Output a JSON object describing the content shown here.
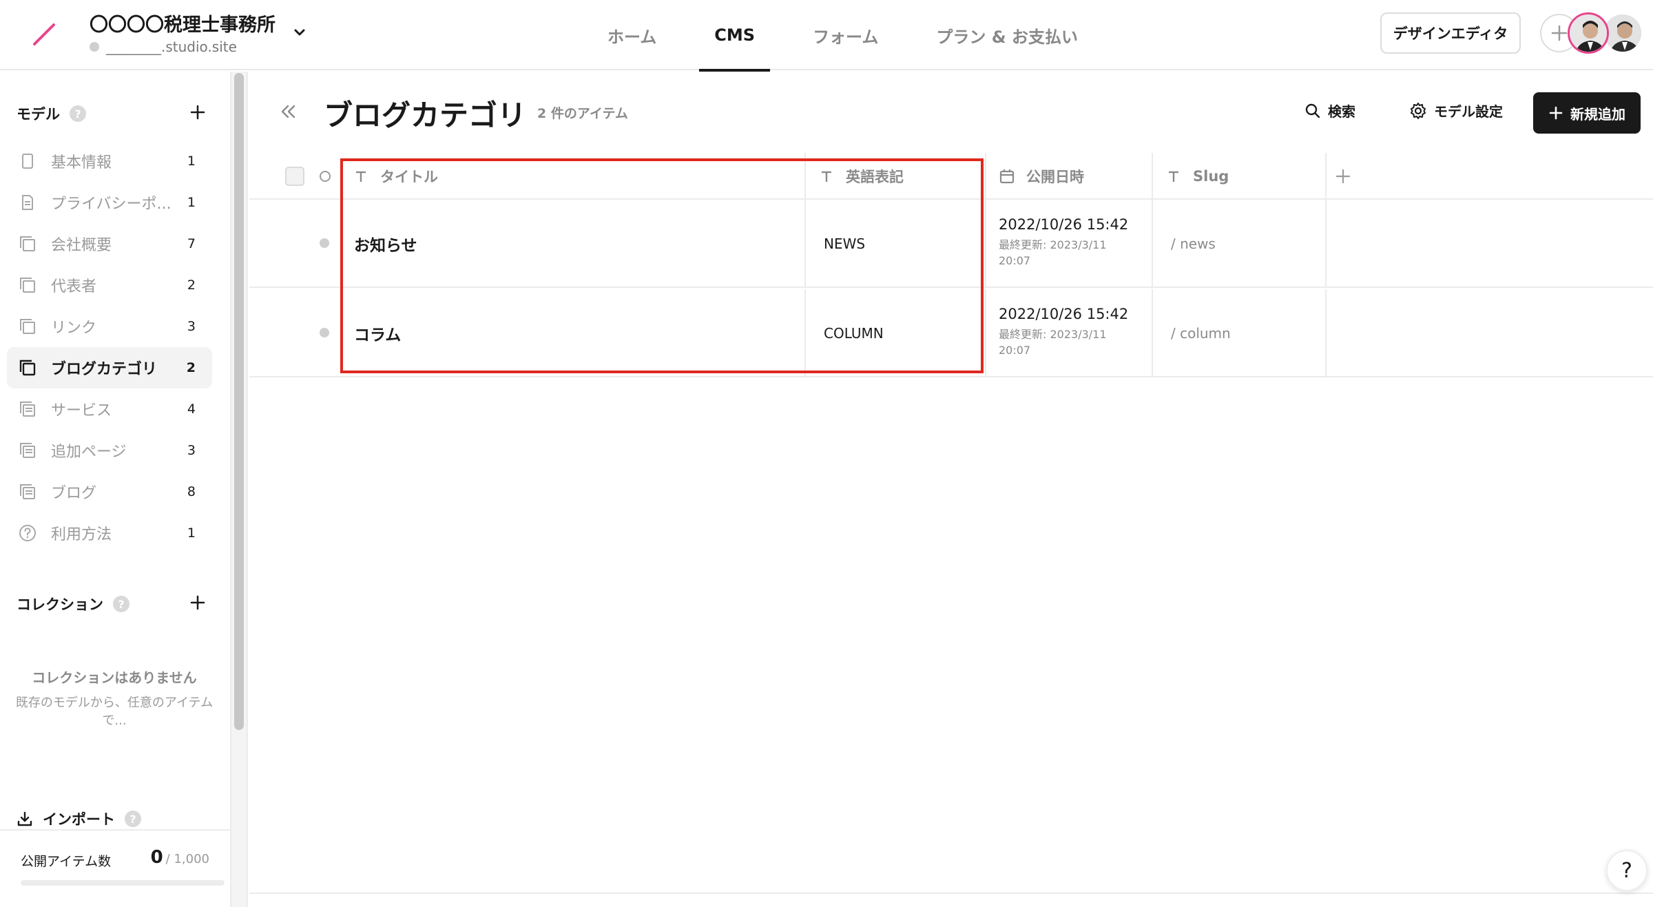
{
  "header": {
    "site_name": "〇〇〇〇税理士事務所",
    "site_url": "________.studio.site",
    "nav_tabs": [
      {
        "label": "ホーム",
        "active": false
      },
      {
        "label": "CMS",
        "active": true
      },
      {
        "label": "フォーム",
        "active": false
      },
      {
        "label": "プラン & お支払い",
        "active": false
      }
    ],
    "design_editor_label": "デザインエディタ"
  },
  "sidebar": {
    "models_heading": "モデル",
    "help_glyph": "?",
    "models": [
      {
        "label": "基本情報",
        "count": "1",
        "icon": "single-page-icon",
        "active": false
      },
      {
        "label": "プライバシーポ...",
        "count": "1",
        "icon": "document-icon",
        "active": false
      },
      {
        "label": "会社概要",
        "count": "7",
        "icon": "collection-icon",
        "active": false
      },
      {
        "label": "代表者",
        "count": "2",
        "icon": "collection-icon",
        "active": false
      },
      {
        "label": "リンク",
        "count": "3",
        "icon": "collection-icon",
        "active": false
      },
      {
        "label": "ブログカテゴリ",
        "count": "2",
        "icon": "collection-icon",
        "active": true
      },
      {
        "label": "サービス",
        "count": "4",
        "icon": "list-collection-icon",
        "active": false
      },
      {
        "label": "追加ページ",
        "count": "3",
        "icon": "list-collection-icon",
        "active": false
      },
      {
        "label": "ブログ",
        "count": "8",
        "icon": "list-collection-icon",
        "active": false
      },
      {
        "label": "利用方法",
        "count": "1",
        "icon": "question-circle-icon",
        "active": false
      }
    ],
    "collections_heading": "コレクション",
    "empty_title": "コレクションはありません",
    "empty_desc": "既存のモデルから、任意のアイテムで...",
    "import_label": "インポート",
    "published_label": "公開アイテム数",
    "published_count": "0",
    "published_limit": "/ 1,000",
    "published_fraction": 0
  },
  "main": {
    "title": "ブログカテゴリ",
    "item_count": "2 件のアイテム",
    "search_label": "検索",
    "model_settings_label": "モデル設定",
    "new_label": "新規追加",
    "columns": [
      {
        "label": "タイトル",
        "icon": "text-type-icon"
      },
      {
        "label": "英語表記",
        "icon": "text-type-icon"
      },
      {
        "label": "公開日時",
        "icon": "calendar-icon"
      },
      {
        "label": "Slug",
        "icon": "text-type-icon"
      }
    ],
    "rows": [
      {
        "title": "お知らせ",
        "english": "NEWS",
        "published": "2022/10/26 15:42",
        "updated": "最終更新: 2023/3/11 20:07",
        "slug": "/ news"
      },
      {
        "title": "コラム",
        "english": "COLUMN",
        "published": "2022/10/26 15:42",
        "updated": "最終更新: 2023/3/11 20:07",
        "slug": "/ column"
      }
    ]
  },
  "help_button_glyph": "?",
  "colors": {
    "accent_pink": "#e8448d",
    "highlight_red": "#e0281e",
    "primary_dark": "#1a1a1a"
  }
}
